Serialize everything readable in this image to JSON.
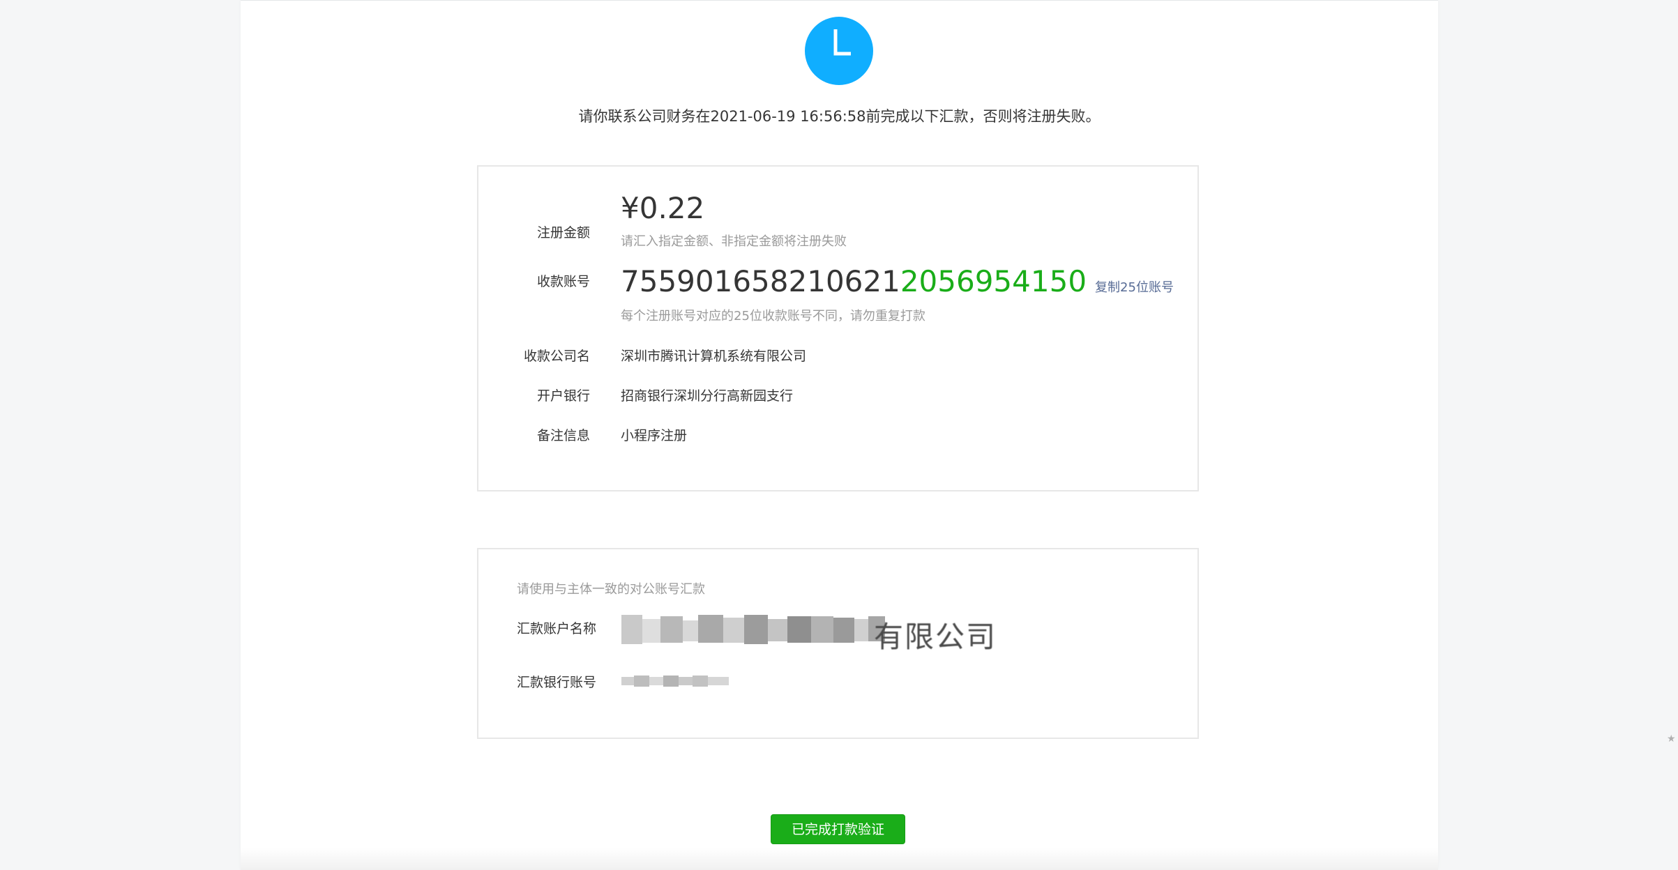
{
  "notice": "请你联系公司财务在2021-06-19 16:56:58前完成以下汇款，否则将注册失败。",
  "info": {
    "amount_label": "注册金额",
    "amount_value": "¥0.22",
    "amount_hint": "请汇入指定金额、非指定金额将注册失败",
    "account_label": "收款账号",
    "account_prefix": "755901658210621",
    "account_suffix": "2056954150",
    "copy_label": "复制25位账号",
    "account_hint": "每个注册账号对应的25位收款账号不同，请勿重复打款",
    "company_label": "收款公司名",
    "company_value": "深圳市腾讯计算机系统有限公司",
    "bank_label": "开户银行",
    "bank_value": "招商银行深圳分行高新园支行",
    "remark_label": "备注信息",
    "remark_value": "小程序注册"
  },
  "payer": {
    "hint": "请使用与主体一致的对公账号汇款",
    "name_label": "汇款账户名称",
    "name_visible_suffix": "有限公司",
    "account_label": "汇款银行账号"
  },
  "confirm_button": "已完成打款验证",
  "colors": {
    "accent_green": "#1aad19",
    "clock_blue": "#10aeff",
    "link_blue": "#576b95"
  },
  "icons": {
    "status": "clock-icon"
  }
}
